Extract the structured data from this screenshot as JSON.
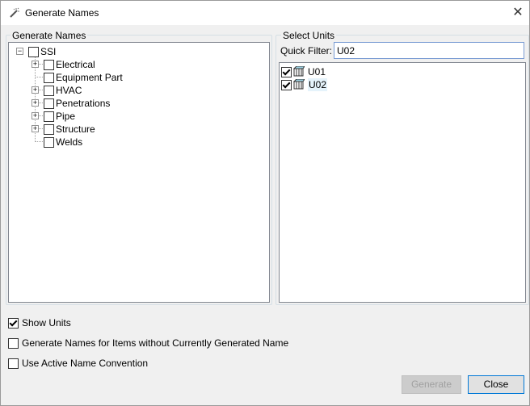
{
  "window": {
    "title": "Generate Names",
    "close_glyph": "✕",
    "icon": "wand-icon"
  },
  "generate_names": {
    "group_label": "Generate Names",
    "root": {
      "label": "SSI",
      "expander": "⊟",
      "checked": false
    },
    "items": [
      {
        "label": "Electrical",
        "has_children": true,
        "checked": false
      },
      {
        "label": "Equipment Part",
        "has_children": false,
        "checked": false
      },
      {
        "label": "HVAC",
        "has_children": true,
        "checked": false
      },
      {
        "label": "Penetrations",
        "has_children": true,
        "checked": false
      },
      {
        "label": "Pipe",
        "has_children": true,
        "checked": false
      },
      {
        "label": "Structure",
        "has_children": true,
        "checked": false
      },
      {
        "label": "Welds",
        "has_children": false,
        "checked": false
      }
    ]
  },
  "select_units": {
    "group_label": "Select Units",
    "filter_label": "Quick Filter:",
    "filter_value": "U02",
    "units": [
      {
        "label": "U01",
        "checked": true
      },
      {
        "label": "U02",
        "checked": true
      }
    ]
  },
  "options": {
    "show_units": {
      "label": "Show Units",
      "checked": true
    },
    "items_without_name": {
      "label": "Generate Names for Items without Currently Generated Name",
      "checked": false
    },
    "active_convention": {
      "label": "Use Active Name Convention",
      "checked": false
    }
  },
  "buttons": {
    "generate": "Generate",
    "close": "Close"
  }
}
